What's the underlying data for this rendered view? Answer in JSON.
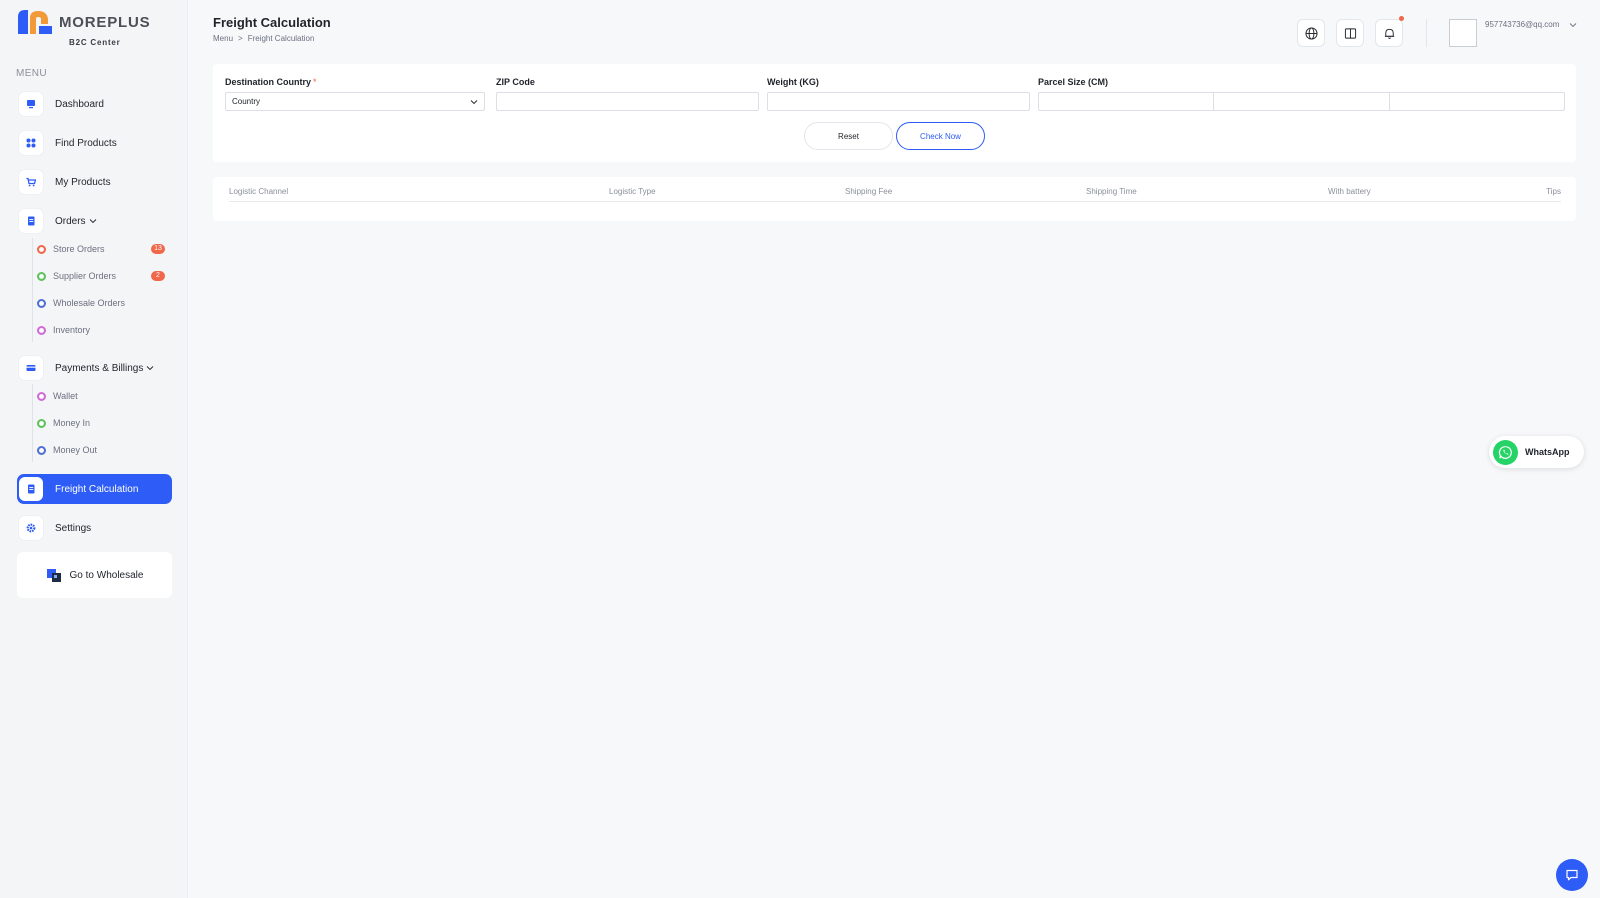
{
  "brand": {
    "name": "MOREPLUS",
    "subtitle": "B2C Center",
    "colors": {
      "accent": "#2d5cf6",
      "logo_blue": "#2d5cf6",
      "logo_orange": "#f29a37",
      "badge": "#f0674a"
    }
  },
  "sidebar": {
    "menu_title": "MENU",
    "items": {
      "dashboard": {
        "label": "Dashboard",
        "icon": "monitor-icon"
      },
      "find_products": {
        "label": "Find Products",
        "icon": "grid-icon"
      },
      "my_products": {
        "label": "My Products",
        "icon": "cart-icon"
      },
      "orders": {
        "label": "Orders",
        "icon": "document-icon",
        "children": [
          {
            "label": "Store Orders",
            "badge": "13",
            "color": "#f0674a"
          },
          {
            "label": "Supplier Orders",
            "badge": "2",
            "color": "#5ec25b"
          },
          {
            "label": "Wholesale Orders",
            "badge": "",
            "color": "#4f6fd6"
          },
          {
            "label": "Inventory",
            "badge": "",
            "color": "#d16ad8"
          }
        ]
      },
      "payments": {
        "label": "Payments & Billings",
        "icon": "card-icon",
        "children": [
          {
            "label": "Wallet",
            "color": "#d16ad8"
          },
          {
            "label": "Money In",
            "color": "#5ec25b"
          },
          {
            "label": "Money Out",
            "color": "#4f6fd6"
          }
        ]
      },
      "freight": {
        "label": "Freight Calculation",
        "icon": "document-icon",
        "active": true
      },
      "settings": {
        "label": "Settings",
        "icon": "gear-icon"
      }
    },
    "wholesale_button": "Go to Wholesale"
  },
  "header": {
    "title": "Freight Calculation",
    "breadcrumb": {
      "root": "Menu",
      "separator": ">",
      "current": "Freight Calculation"
    },
    "user_email": "957743736@qq.com",
    "icons": [
      "globe-icon",
      "book-icon",
      "bell-icon"
    ]
  },
  "form": {
    "destination": {
      "label": "Destination Country",
      "required_mark": "*",
      "value": "Country"
    },
    "zip": {
      "label": "ZIP Code",
      "value": ""
    },
    "weight": {
      "label": "Weight (KG)",
      "value": ""
    },
    "parcel": {
      "label": "Parcel Size (CM)",
      "values": [
        "",
        "",
        ""
      ]
    },
    "reset_label": "Reset",
    "check_label": "Check Now"
  },
  "table": {
    "columns": [
      "Logistic Channel",
      "Logistic Type",
      "Shipping Fee",
      "Shipping Time",
      "With battery",
      "Tips"
    ],
    "rows": []
  },
  "floating": {
    "whatsapp_label": "WhatsApp"
  }
}
